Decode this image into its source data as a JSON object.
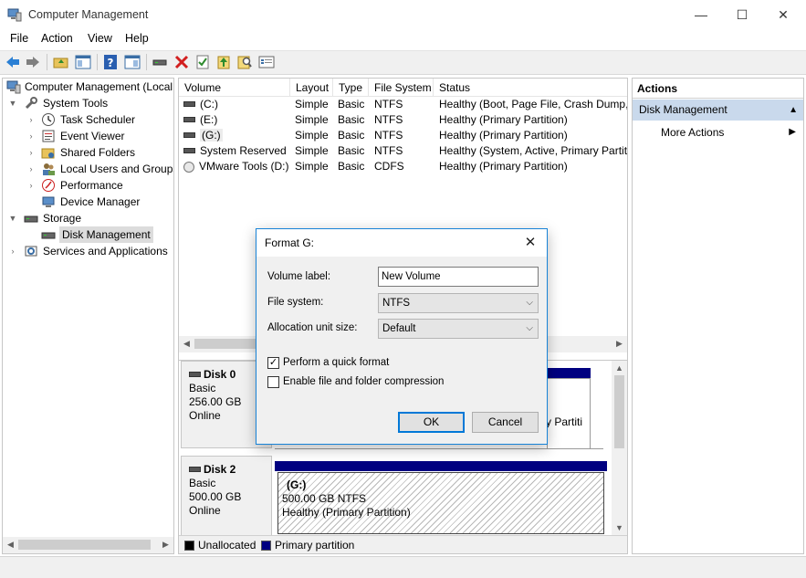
{
  "window": {
    "title": "Computer Management",
    "minimize_glyph": "—",
    "maximize_glyph": "☐",
    "close_glyph": "✕"
  },
  "menu": [
    "File",
    "Action",
    "View",
    "Help"
  ],
  "toolbar_icons": [
    "back-icon",
    "forward-icon",
    "up-folder-icon",
    "show-hide-tree-icon",
    "help-icon",
    "show-action-pane-icon",
    "connect-icon",
    "delete-icon",
    "check-icon",
    "import-icon",
    "search-icon",
    "properties-icon"
  ],
  "tree": {
    "root": "Computer Management (Local",
    "system_tools": "System Tools",
    "task_scheduler": "Task Scheduler",
    "event_viewer": "Event Viewer",
    "shared_folders": "Shared Folders",
    "local_users": "Local Users and Groups",
    "performance": "Performance",
    "device_manager": "Device Manager",
    "storage": "Storage",
    "disk_management": "Disk Management",
    "services": "Services and Applications"
  },
  "volume_table": {
    "headers": [
      "Volume",
      "Layout",
      "Type",
      "File System",
      "Status"
    ],
    "rows": [
      {
        "volume": "(C:)",
        "layout": "Simple",
        "type": "Basic",
        "fs": "NTFS",
        "status": "Healthy (Boot, Page File, Crash Dump,",
        "icon": "drive-icon"
      },
      {
        "volume": "(E:)",
        "layout": "Simple",
        "type": "Basic",
        "fs": "NTFS",
        "status": "Healthy (Primary Partition)",
        "icon": "drive-icon"
      },
      {
        "volume": "(G:)",
        "layout": "Simple",
        "type": "Basic",
        "fs": "NTFS",
        "status": "Healthy (Primary Partition)",
        "icon": "drive-icon"
      },
      {
        "volume": "System Reserved",
        "layout": "Simple",
        "type": "Basic",
        "fs": "NTFS",
        "status": "Healthy (System, Active, Primary Partiti",
        "icon": "drive-icon"
      },
      {
        "volume": "VMware Tools (D:)",
        "layout": "Simple",
        "type": "Basic",
        "fs": "CDFS",
        "status": "Healthy (Primary Partition)",
        "icon": "cd-icon"
      }
    ]
  },
  "disks": [
    {
      "name": "Disk 0",
      "type": "Basic",
      "size": "256.00 GB",
      "state": "Online",
      "partial_text": "y Partiti"
    },
    {
      "name": "Disk 2",
      "type": "Basic",
      "size": "500.00 GB",
      "state": "Online",
      "partition": {
        "name": "(G:)",
        "size_fs": "500.00 GB NTFS",
        "status": "Healthy (Primary Partition)"
      }
    }
  ],
  "legend": [
    {
      "label": "Unallocated",
      "color": "#000000"
    },
    {
      "label": "Primary partition",
      "color": "#000080"
    }
  ],
  "actions": {
    "header": "Actions",
    "group": "Disk Management",
    "more": "More Actions"
  },
  "dialog": {
    "title": "Format G:",
    "volume_label_label": "Volume label:",
    "volume_label_value": "New Volume",
    "file_system_label": "File system:",
    "file_system_value": "NTFS",
    "alloc_label": "Allocation unit size:",
    "alloc_value": "Default",
    "quick_format_label": "Perform a quick format",
    "quick_format_checked": true,
    "compression_label": "Enable file and folder compression",
    "compression_checked": false,
    "ok": "OK",
    "cancel": "Cancel"
  },
  "colors": {
    "accent": "#0078d7",
    "primary_partition": "#000080",
    "selection": "#c9d9ec"
  }
}
